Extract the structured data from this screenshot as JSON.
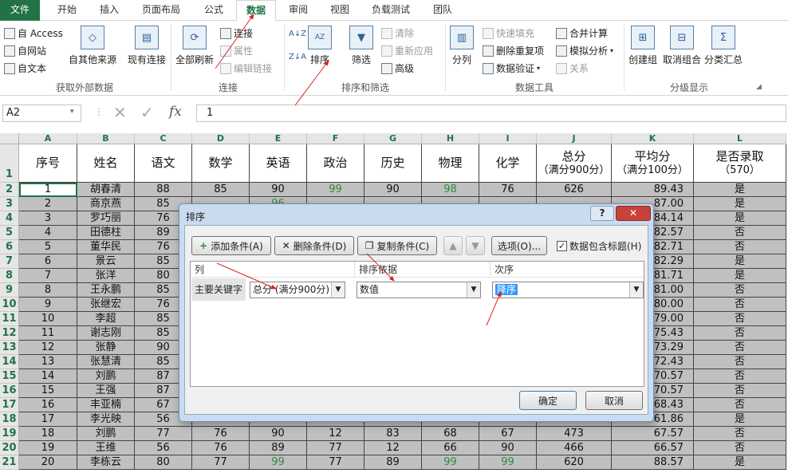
{
  "ribbon_tabs": [
    "文件",
    "开始",
    "插入",
    "页面布局",
    "公式",
    "数据",
    "审阅",
    "视图",
    "负载测试",
    "团队"
  ],
  "ribbon": {
    "get_external": {
      "access": "自 Access",
      "web": "自网站",
      "text": "自文本",
      "other": "自其他来源",
      "existing": "现有连接",
      "group": "获取外部数据"
    },
    "connections": {
      "refresh_all": "全部刷新",
      "connections": "连接",
      "properties": "属性",
      "edit_links": "编辑链接",
      "group": "连接"
    },
    "sort_filter": {
      "sort_az": "A↓Z",
      "sort_za": "Z↓A",
      "sort": "排序",
      "filter": "筛选",
      "clear": "清除",
      "reapply": "重新应用",
      "advanced": "高级",
      "group": "排序和筛选"
    },
    "data_tools": {
      "text_to_columns": "分列",
      "flash_fill": "快速填充",
      "remove_dup": "删除重复项",
      "validation": "数据验证",
      "consolidate": "合并计算",
      "whatif": "模拟分析",
      "relations": "关系",
      "group": "数据工具"
    },
    "outline": {
      "group_btn": "创建组",
      "ungroup": "取消组合",
      "subtotal": "分类汇总",
      "group": "分级显示"
    }
  },
  "formula_bar": {
    "name_box": "A2",
    "fx": "fx",
    "value": "1"
  },
  "columns": [
    "A",
    "B",
    "C",
    "D",
    "E",
    "F",
    "G",
    "H",
    "I",
    "J",
    "K",
    "L"
  ],
  "headers": [
    "序号",
    "姓名",
    "语文",
    "数学",
    "英语",
    "政治",
    "历史",
    "物理",
    "化学",
    "总分\n（满分900分）",
    "平均分\n（满分100分）",
    "是否录取\n（570）"
  ],
  "row_numbers": [
    "1",
    "2",
    "3",
    "4",
    "5",
    "6",
    "7",
    "8",
    "9",
    "10",
    "11",
    "12",
    "13",
    "14",
    "15",
    "16",
    "17",
    "18",
    "19",
    "20",
    "21"
  ],
  "rows": [
    [
      "1",
      "胡春清",
      "88",
      "85",
      "90",
      "99",
      "90",
      "98",
      "76",
      "626",
      "89.43",
      "是"
    ],
    [
      "2",
      "商京燕",
      "85",
      "",
      "96",
      "",
      "",
      "",
      "",
      "",
      "87.00",
      "是"
    ],
    [
      "3",
      "罗巧丽",
      "76",
      "",
      "",
      "",
      "",
      "",
      "",
      "",
      "84.14",
      "是"
    ],
    [
      "4",
      "田德柱",
      "89",
      "",
      "",
      "",
      "",
      "",
      "",
      "",
      "82.57",
      "否"
    ],
    [
      "5",
      "董华民",
      "76",
      "",
      "",
      "",
      "",
      "",
      "",
      "",
      "82.71",
      "否"
    ],
    [
      "6",
      "景云",
      "85",
      "",
      "",
      "",
      "",
      "",
      "",
      "",
      "82.29",
      "是"
    ],
    [
      "7",
      "张洋",
      "80",
      "",
      "",
      "",
      "",
      "",
      "",
      "",
      "81.71",
      "是"
    ],
    [
      "8",
      "王永鹏",
      "85",
      "",
      "",
      "",
      "",
      "",
      "",
      "",
      "81.00",
      "否"
    ],
    [
      "9",
      "张继宏",
      "76",
      "",
      "",
      "",
      "",
      "",
      "",
      "",
      "80.00",
      "否"
    ],
    [
      "10",
      "李超",
      "85",
      "",
      "",
      "",
      "",
      "",
      "",
      "",
      "79.00",
      "否"
    ],
    [
      "11",
      "谢志刚",
      "85",
      "",
      "",
      "",
      "",
      "",
      "",
      "",
      "75.43",
      "否"
    ],
    [
      "12",
      "张静",
      "90",
      "",
      "",
      "",
      "",
      "",
      "",
      "",
      "73.29",
      "否"
    ],
    [
      "13",
      "张慧清",
      "85",
      "",
      "",
      "",
      "",
      "",
      "",
      "",
      "72.43",
      "否"
    ],
    [
      "14",
      "刘鹏",
      "87",
      "",
      "",
      "",
      "",
      "",
      "",
      "",
      "70.57",
      "否"
    ],
    [
      "15",
      "王强",
      "87",
      "",
      "",
      "",
      "",
      "",
      "",
      "",
      "70.57",
      "否"
    ],
    [
      "16",
      "丰亚楠",
      "67",
      "",
      "",
      "",
      "",
      "",
      "",
      "",
      "68.43",
      "否"
    ],
    [
      "17",
      "李光映",
      "56",
      "",
      "",
      "",
      "",
      "",
      "",
      "",
      "61.86",
      "是"
    ],
    [
      "18",
      "刘鹏",
      "77",
      "76",
      "90",
      "12",
      "83",
      "68",
      "67",
      "473",
      "67.57",
      "否"
    ],
    [
      "19",
      "王维",
      "56",
      "76",
      "89",
      "77",
      "12",
      "66",
      "90",
      "466",
      "66.57",
      "否"
    ],
    [
      "20",
      "李栋云",
      "80",
      "77",
      "99",
      "77",
      "89",
      "99",
      "99",
      "620",
      "88.57",
      "是"
    ]
  ],
  "green_cells": [
    "0-5",
    "0-7",
    "1-4",
    "19-4",
    "19-7",
    "19-8"
  ],
  "dialog": {
    "title": "排序",
    "help": "?",
    "close": "✕",
    "add_condition": "添加条件(A)",
    "delete_condition": "删除条件(D)",
    "copy_condition": "复制条件(C)",
    "up": "▲",
    "down": "▼",
    "options": "选项(O)...",
    "has_header_label": "数据包含标题(H)",
    "has_header_checked": "✓",
    "col_header": "列",
    "sort_on_header": "排序依据",
    "order_header": "次序",
    "primary_key_label": "主要关键字",
    "column_value": "总分 (满分900分)",
    "sort_on_value": "数值",
    "order_value": "降序",
    "ok": "确定",
    "cancel": "取消"
  }
}
